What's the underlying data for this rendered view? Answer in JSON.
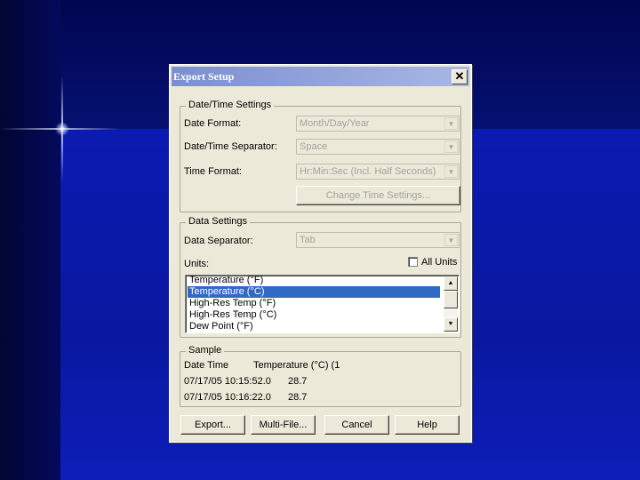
{
  "dialog": {
    "title": "Export Setup",
    "close_glyph": "✕"
  },
  "datetime": {
    "group_title": "Date/Time Settings",
    "date_format_label": "Date Format:",
    "date_format_value": "Month/Day/Year",
    "separator_label": "Date/Time Separator:",
    "separator_value": "Space",
    "time_format_label": "Time Format:",
    "time_format_value": "Hr:Min:Sec (Incl. Half Seconds)",
    "change_button": "Change Time Settings..."
  },
  "data_settings": {
    "group_title": "Data Settings",
    "separator_label": "Data Separator:",
    "separator_value": "Tab",
    "units_label": "Units:",
    "all_units_label": "All Units",
    "all_units_checked": false,
    "units_list": [
      {
        "label": "Temperature (°F)",
        "selected": false
      },
      {
        "label": "Temperature (°C)",
        "selected": true
      },
      {
        "label": "High-Res Temp (°F)",
        "selected": false
      },
      {
        "label": "High-Res Temp (°C)",
        "selected": false
      },
      {
        "label": "Dew Point (°F)",
        "selected": false
      }
    ]
  },
  "sample": {
    "group_title": "Sample",
    "headers": [
      "Date Time",
      "Temperature (°C) (1"
    ],
    "rows": [
      [
        "07/17/05 10:15:52.0",
        "28.7"
      ],
      [
        "07/17/05 10:16:22.0",
        "28.7"
      ]
    ]
  },
  "buttons": {
    "export": "Export...",
    "multifile": "Multi-File...",
    "cancel": "Cancel",
    "help": "Help"
  },
  "colors": {
    "title_bar_start": "#7b8fd0",
    "selection": "#316ac5",
    "dialog_face": "#ece9d8"
  }
}
